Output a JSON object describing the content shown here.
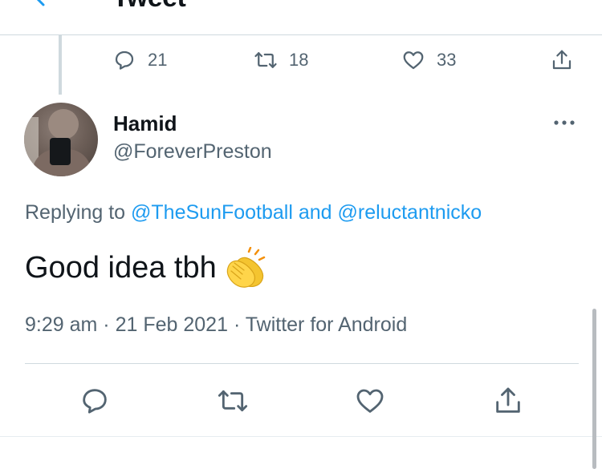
{
  "header": {
    "title": "Tweet",
    "back_icon": "back-arrow-icon"
  },
  "parent_actions": {
    "reply_count": "21",
    "retweet_count": "18",
    "like_count": "33"
  },
  "reply": {
    "display_name": "Hamid",
    "handle": "@ForeverPreston",
    "replying_prefix": "Replying to",
    "mention_1": "@TheSunFootball",
    "replying_and": "and",
    "mention_2": "@reluctantnicko",
    "text": "Good idea tbh",
    "emoji_icon": "clapping-hands-icon",
    "time": "9:29 am",
    "sep_1": "·",
    "date": "21 Feb 2021",
    "sep_2": "·",
    "source": "Twitter for Android"
  },
  "colors": {
    "accent": "#1d9bf0",
    "secondary_text": "#536471",
    "primary_text": "#0f1419",
    "divider": "#cfd9de"
  }
}
